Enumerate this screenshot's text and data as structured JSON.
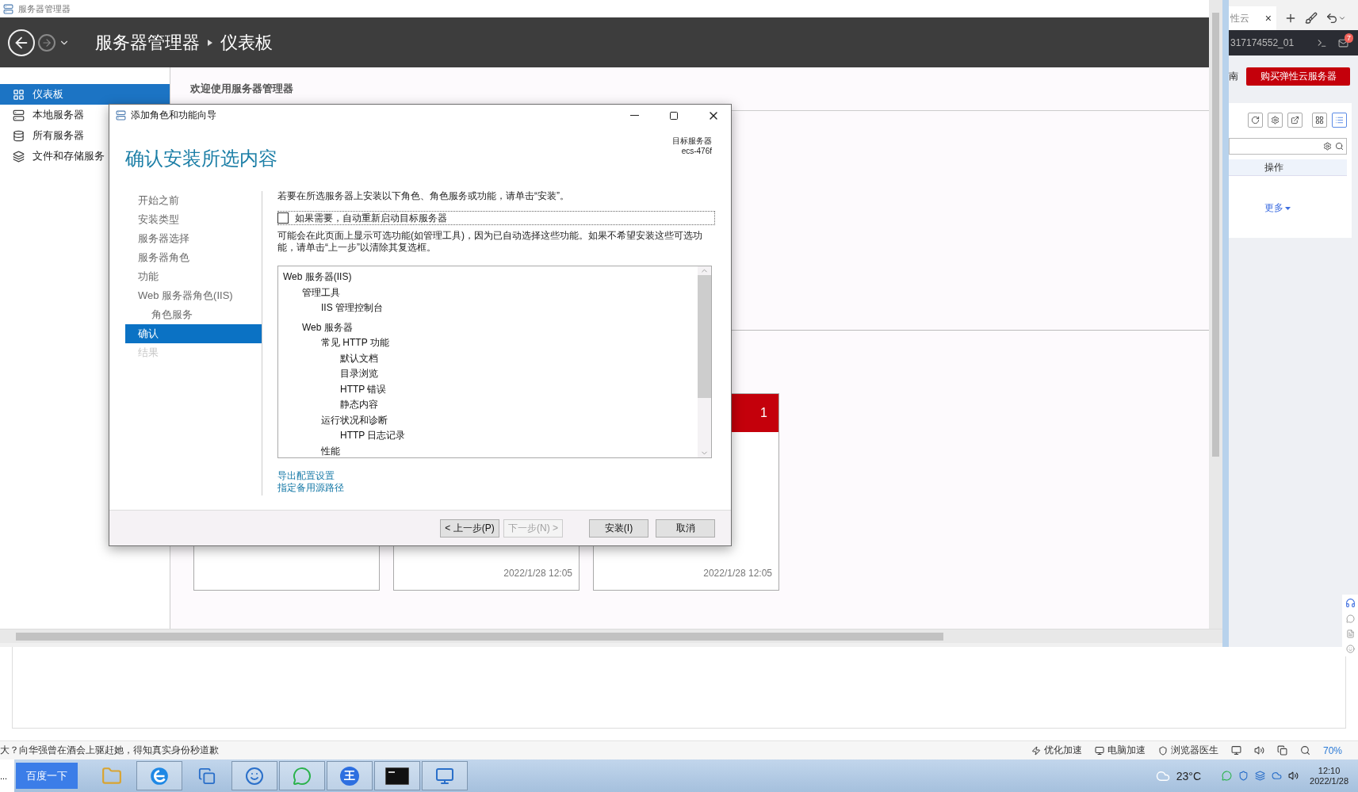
{
  "remote_window": {
    "title": "服务器管理器",
    "breadcrumb": [
      "服务器管理器",
      "仪表板"
    ],
    "sidebar": [
      {
        "label": "仪表板",
        "selected": true
      },
      {
        "label": "本地服务器",
        "selected": false
      },
      {
        "label": "所有服务器",
        "selected": false
      },
      {
        "label": "文件和存储服务",
        "selected": false
      }
    ],
    "welcome": "欢迎使用服务器管理器",
    "tiles": [
      {
        "kind": "plain"
      },
      {
        "kind": "plain",
        "time": "2022/1/28 12:05"
      },
      {
        "kind": "alert",
        "count": "1",
        "time": "2022/1/28 12:05"
      }
    ]
  },
  "dialog": {
    "title": "添加角色和功能向导",
    "heading": "确认安装所选内容",
    "target_label": "目标服务器",
    "target_server": "ecs-476f",
    "steps": [
      {
        "label": "开始之前",
        "selected": false,
        "disabled": false
      },
      {
        "label": "安装类型",
        "selected": false,
        "disabled": false
      },
      {
        "label": "服务器选择",
        "selected": false,
        "disabled": false
      },
      {
        "label": "服务器角色",
        "selected": false,
        "disabled": false
      },
      {
        "label": "功能",
        "selected": false,
        "disabled": false
      },
      {
        "label": "Web 服务器角色(IIS)",
        "selected": false,
        "disabled": false,
        "children": [
          {
            "label": "角色服务",
            "selected": false,
            "disabled": false
          }
        ]
      },
      {
        "label": "确认",
        "selected": true,
        "disabled": false
      },
      {
        "label": "结果",
        "selected": false,
        "disabled": true
      }
    ],
    "instruction": "若要在所选服务器上安装以下角色、角色服务或功能，请单击“安装”。",
    "restart": {
      "label": "如果需要，自动重新启动目标服务器",
      "checked": false
    },
    "note": "可能会在此页面上显示可选功能(如管理工具)，因为已自动选择这些功能。如果不希望安装这些可选功能，请单击“上一步”以清除其复选框。",
    "features": [
      {
        "label": "Web 服务器(IIS)",
        "children": [
          {
            "label": "管理工具",
            "children": [
              {
                "label": "IIS 管理控制台"
              }
            ]
          },
          {
            "label": "Web 服务器",
            "children": [
              {
                "label": "常见 HTTP 功能",
                "children": [
                  {
                    "label": "默认文档"
                  },
                  {
                    "label": "目录浏览"
                  },
                  {
                    "label": "HTTP 错误"
                  },
                  {
                    "label": "静态内容"
                  }
                ]
              },
              {
                "label": "运行状况和诊断",
                "children": [
                  {
                    "label": "HTTP 日志记录"
                  }
                ]
              },
              {
                "label": "性能"
              }
            ]
          }
        ]
      }
    ],
    "links": [
      "导出配置设置",
      "指定备用源路径"
    ],
    "buttons": [
      {
        "label": "< 上一步(P)",
        "disabled": false,
        "kind": "nav"
      },
      {
        "label": "下一步(N) >",
        "disabled": true,
        "kind": "nav"
      },
      {
        "label": "安装(I)",
        "disabled": false,
        "kind": "action"
      },
      {
        "label": "取消",
        "disabled": false,
        "kind": "action"
      }
    ]
  },
  "browser": {
    "tab_title": "性云",
    "tab_close": "×",
    "account": "317174552_01",
    "mail_badge": "7",
    "nav_fragment": "南",
    "buy_button": "购买弹性云服务器",
    "views": [
      {
        "kind": "grid",
        "selected": false
      },
      {
        "kind": "list",
        "selected": true
      }
    ],
    "column": "操作",
    "more_link": "更多"
  },
  "status_bar": {
    "news": "大？向华强曾在酒会上驱赶她，得知真实身份秒道歉",
    "tools": [
      "优化加速",
      "电脑加速",
      "浏览器医生"
    ],
    "zoom": "70%"
  },
  "taskbar": {
    "more": "...",
    "search_button": "百度一下",
    "app_label": "王",
    "weather": "23°C",
    "time": "12:10",
    "date": "2022/1/28"
  }
}
